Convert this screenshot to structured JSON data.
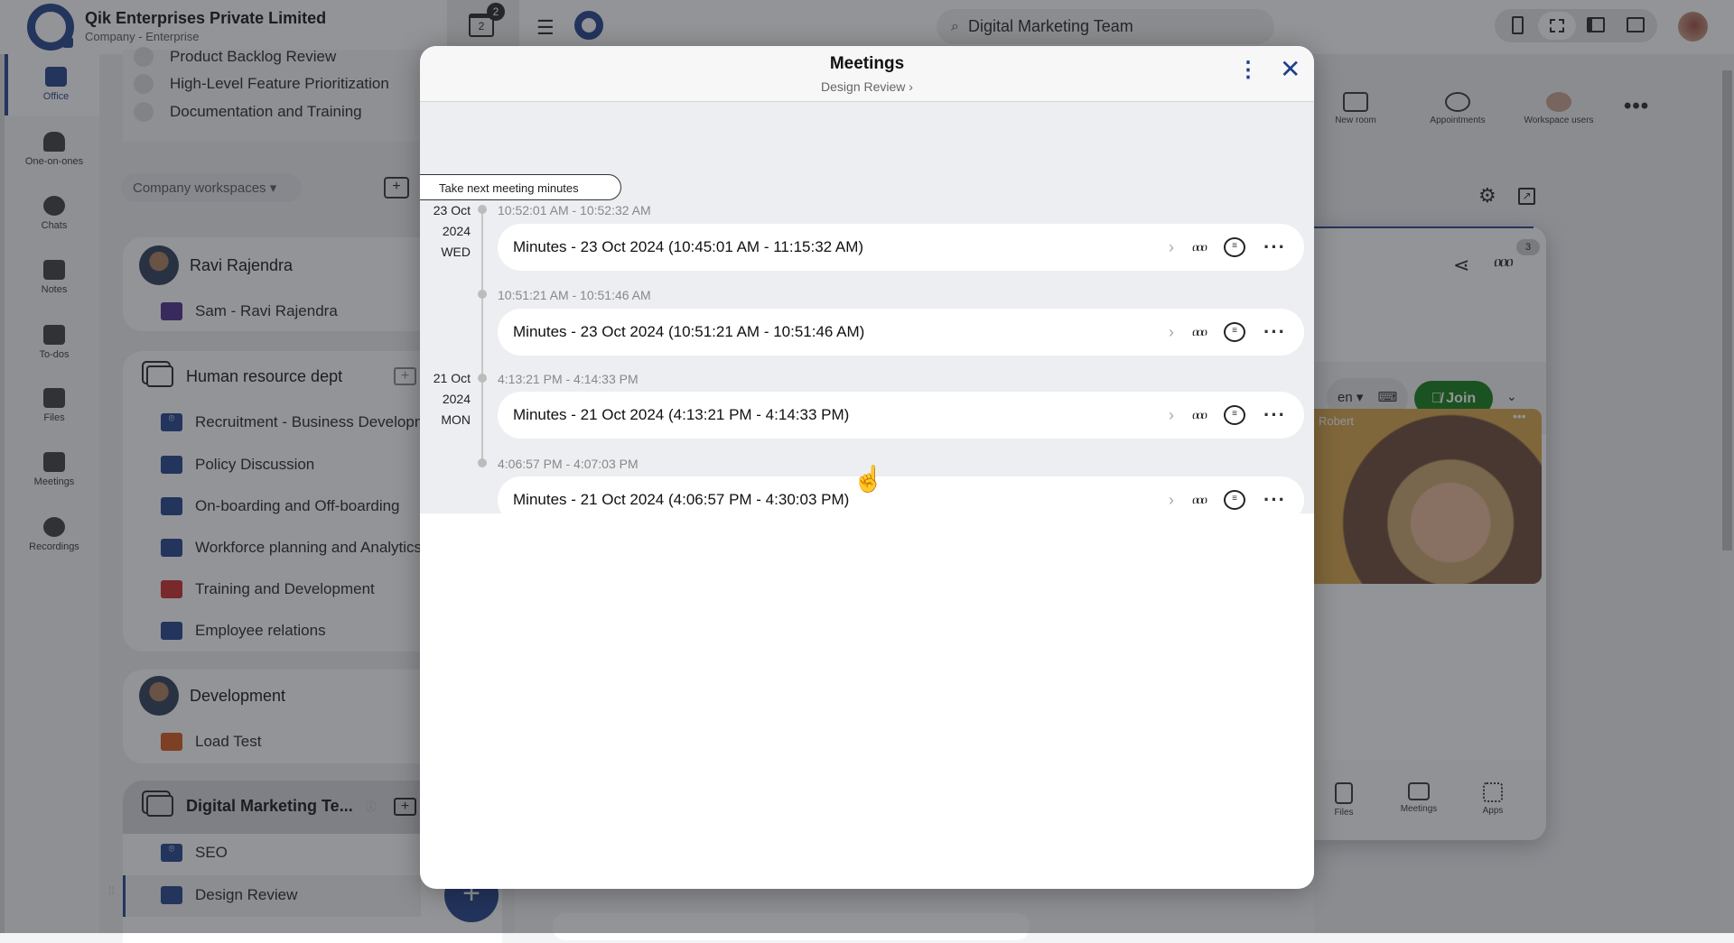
{
  "topbar": {
    "org_name": "Qik Enterprises Private Limited",
    "org_type": "Company - Enterprise",
    "calendar_day": "2",
    "calendar_badge": "2",
    "search_value": "Digital Marketing Team"
  },
  "rail": [
    {
      "label": "Office",
      "icon": "briefcase-icon",
      "active": true
    },
    {
      "label": "One-on-ones",
      "icon": "people-icon"
    },
    {
      "label": "Chats",
      "icon": "chat-icon"
    },
    {
      "label": "Notes",
      "icon": "notes-icon"
    },
    {
      "label": "To-dos",
      "icon": "checkbox-icon"
    },
    {
      "label": "Files",
      "icon": "files-icon"
    },
    {
      "label": "Meetings",
      "icon": "meetings-icon"
    },
    {
      "label": "Recordings",
      "icon": "recordings-icon"
    }
  ],
  "panel": {
    "top_items": [
      "Product Backlog Review",
      "High-Level Feature Prioritization",
      "Documentation and Training"
    ],
    "workspaces_filter": "Company workspaces",
    "groups": [
      {
        "title": "Ravi Rajendra",
        "items": [
          {
            "label": "Sam - Ravi Rajendra",
            "color": "#4b2a8c"
          }
        ]
      },
      {
        "title": "Human resource dept",
        "items": [
          {
            "label": "Recruitment - Business Development",
            "color": "#1e3f8a"
          },
          {
            "label": "Policy Discussion",
            "color": "#1e3f8a"
          },
          {
            "label": "On-boarding and Off-boarding",
            "color": "#1e3f8a"
          },
          {
            "label": "Workforce planning and Analytics",
            "color": "#1e3f8a"
          },
          {
            "label": "Training and Development",
            "color": "#c62828"
          },
          {
            "label": "Employee relations",
            "color": "#1e3f8a"
          }
        ]
      },
      {
        "title": "Development",
        "items": [
          {
            "label": "Load Test",
            "color": "#d2571a"
          }
        ]
      },
      {
        "title": "Digital Marketing Te...",
        "items": [
          {
            "label": "SEO",
            "color": "#1e3f8a"
          },
          {
            "label": "Design Review",
            "color": "#1e3f8a",
            "selected": true
          }
        ]
      }
    ]
  },
  "right": {
    "tools": [
      "New room",
      "Appointments",
      "Workspace users"
    ],
    "participants_count": "3",
    "language": "en",
    "join_label": "Join",
    "tile_name": "Robert",
    "bottom_tabs": [
      "Files",
      "Meetings",
      "Apps"
    ],
    "join_color": "#0f7a12"
  },
  "modal": {
    "title": "Meetings",
    "subtitle": "Design Review",
    "take_next_label": "Take next meeting minutes",
    "groups": [
      {
        "date": "23 Oct",
        "year": "2024",
        "day": "WED"
      },
      {
        "date": "21 Oct",
        "year": "2024",
        "day": "MON"
      }
    ],
    "entries": [
      {
        "time": "10:52:01 AM - 10:52:32 AM",
        "title": "Minutes - 23 Oct 2024 (10:45:01 AM - 11:15:32 AM)"
      },
      {
        "time": "10:51:21 AM - 10:51:46 AM",
        "title": "Minutes - 23 Oct 2024 (10:51:21 AM - 10:51:46 AM)"
      },
      {
        "time": "4:13:21 PM - 4:14:33 PM",
        "title": "Minutes - 21 Oct 2024 (4:13:21 PM - 4:14:33 PM)"
      },
      {
        "time": "4:06:57 PM - 4:07:03 PM",
        "title": "Minutes - 21 Oct 2024 (4:06:57 PM - 4:30:03 PM)"
      }
    ]
  }
}
